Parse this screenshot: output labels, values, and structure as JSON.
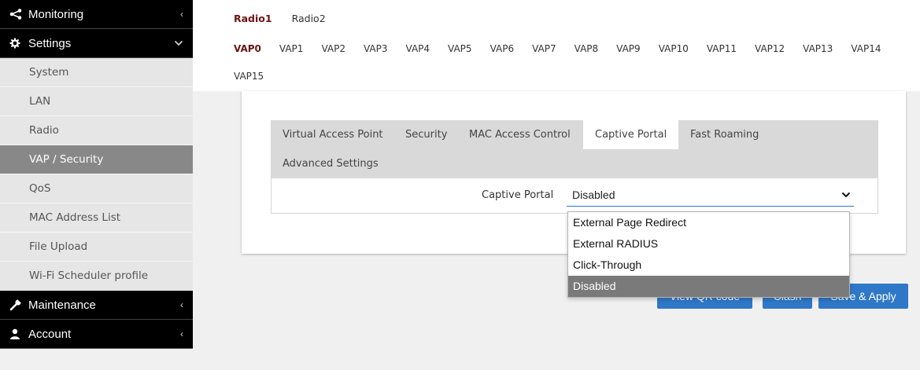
{
  "sidebar": {
    "monitoring": {
      "label": "Monitoring",
      "icon": "share-icon",
      "chevron": "‹"
    },
    "settings": {
      "label": "Settings",
      "icon": "gear-icon",
      "chevron": "⌄"
    },
    "items": [
      {
        "label": "System",
        "active": false
      },
      {
        "label": "LAN",
        "active": false
      },
      {
        "label": "Radio",
        "active": false
      },
      {
        "label": "VAP / Security",
        "active": true
      },
      {
        "label": "QoS",
        "active": false
      },
      {
        "label": "MAC Address List",
        "active": false
      },
      {
        "label": "File Upload",
        "active": false
      },
      {
        "label": "Wi-Fi Scheduler profile",
        "active": false
      }
    ],
    "maintenance": {
      "label": "Maintenance",
      "icon": "wrench-icon",
      "chevron": "‹"
    },
    "account": {
      "label": "Account",
      "icon": "user-icon",
      "chevron": "‹"
    }
  },
  "radio_tabs": [
    "Radio1",
    "Radio2"
  ],
  "radio_active": "Radio1",
  "vap_tabs": [
    "VAP0",
    "VAP1",
    "VAP2",
    "VAP3",
    "VAP4",
    "VAP5",
    "VAP6",
    "VAP7",
    "VAP8",
    "VAP9",
    "VAP10",
    "VAP11",
    "VAP12",
    "VAP13",
    "VAP14",
    "VAP15"
  ],
  "vap_active": "VAP0",
  "panel_tabs": {
    "virtual_ap": "Virtual Access Point",
    "security": "Security",
    "mac": "MAC Access Control",
    "captive": "Captive Portal",
    "fast": "Fast Roaming",
    "advanced": "Advanced Settings"
  },
  "form": {
    "captive_label": "Captive Portal",
    "captive_value": "Disabled"
  },
  "dropdown_options": [
    {
      "label": "External Page Redirect",
      "selected": false
    },
    {
      "label": "External RADIUS",
      "selected": false
    },
    {
      "label": "Click-Through",
      "selected": false
    },
    {
      "label": "Disabled",
      "selected": true
    }
  ],
  "buttons": {
    "qr": "View QR code",
    "clash": "Clash",
    "save": "Save & Apply"
  },
  "colors": {
    "accent": "#2f77c7",
    "active_tab_text": "#6b1414",
    "sidebar_dark": "#000000"
  }
}
